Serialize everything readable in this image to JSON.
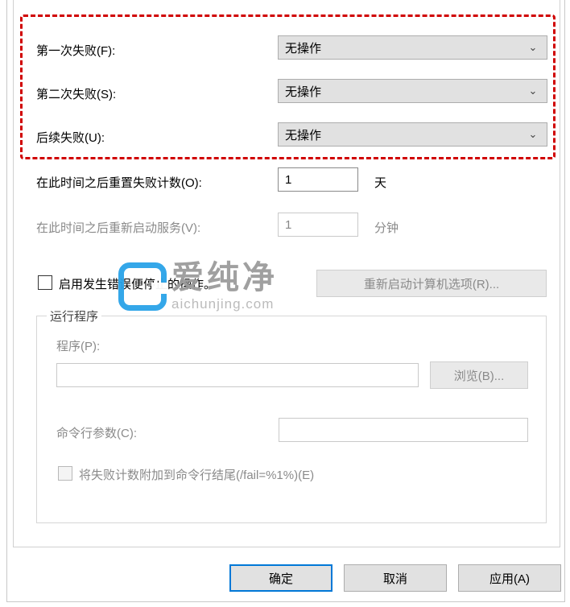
{
  "failures": {
    "first": {
      "label": "第一次失败(F):",
      "value": "无操作"
    },
    "second": {
      "label": "第二次失败(S):",
      "value": "无操作"
    },
    "subseq": {
      "label": "后续失败(U):",
      "value": "无操作"
    }
  },
  "reset_counter": {
    "label": "在此时间之后重置失败计数(O):",
    "value": "1",
    "unit": "天"
  },
  "restart_after": {
    "label": "在此时间之后重新启动服务(V):",
    "value": "1",
    "unit": "分钟"
  },
  "enable_stop_actions": {
    "label": "启用发生错误便停止的操作。"
  },
  "restart_options_btn": "重新启动计算机选项(R)...",
  "run_program": {
    "legend": "运行程序",
    "program_label": "程序(P):",
    "browse_btn": "浏览(B)...",
    "args_label": "命令行参数(C):",
    "append_label": "将失败计数附加到命令行结尾(/fail=%1%)(E)"
  },
  "buttons": {
    "ok": "确定",
    "cancel": "取消",
    "apply": "应用(A)"
  },
  "watermark": {
    "cn": "爱纯净",
    "en": "aichunjing.com"
  }
}
